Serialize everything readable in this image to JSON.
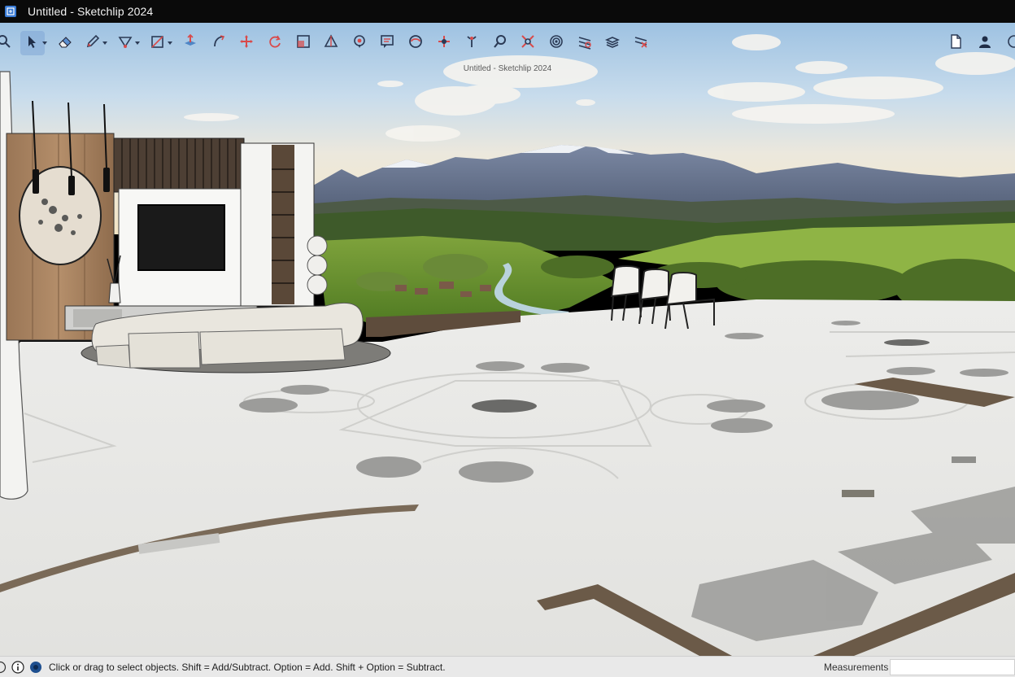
{
  "window": {
    "title": "Untitled - Sketchlip 2024"
  },
  "viewport": {
    "overlay_title": "Untitled - Sketchlip 2024"
  },
  "toolbar": {
    "tools": [
      {
        "name": "search-tool",
        "icon": "magnifier-icon"
      },
      {
        "name": "select-tool",
        "icon": "arrow-cursor-icon",
        "active": true,
        "dropdown": true
      },
      {
        "name": "eraser-tool",
        "icon": "eraser-icon"
      },
      {
        "name": "pencil-tool",
        "icon": "pencil-icon",
        "dropdown": true
      },
      {
        "name": "arc-tool",
        "icon": "arc-icon",
        "dropdown": true
      },
      {
        "name": "rectangle-tool",
        "icon": "rectangle-icon",
        "dropdown": true
      },
      {
        "name": "push-pull-tool",
        "icon": "push-pull-icon"
      },
      {
        "name": "follow-me-tool",
        "icon": "follow-me-icon"
      },
      {
        "name": "move-tool",
        "icon": "move-icon"
      },
      {
        "name": "rotate-tool",
        "icon": "rotate-icon"
      },
      {
        "name": "scale-tool",
        "icon": "scale-icon"
      },
      {
        "name": "tape-measure-tool",
        "icon": "triangle-icon"
      },
      {
        "name": "paint-tool",
        "icon": "paint-icon"
      },
      {
        "name": "text-tool",
        "icon": "text-box-icon"
      },
      {
        "name": "orbit-tool",
        "icon": "orbit-icon"
      },
      {
        "name": "pan-tool",
        "icon": "pan-icon"
      },
      {
        "name": "walk-tool",
        "icon": "walk-icon"
      },
      {
        "name": "zoom-tool",
        "icon": "zoom-icon"
      },
      {
        "name": "zoom-extents-tool",
        "icon": "zoom-extents-icon"
      },
      {
        "name": "position-camera-tool",
        "icon": "camera-target-icon"
      },
      {
        "name": "section-plane-tool",
        "icon": "section-plane-icon"
      },
      {
        "name": "layers-tool",
        "icon": "layers-icon"
      },
      {
        "name": "section-display-tool",
        "icon": "section-display-icon"
      }
    ],
    "right_tools": [
      {
        "name": "document-button",
        "icon": "document-icon"
      },
      {
        "name": "account-button",
        "icon": "user-icon"
      },
      {
        "name": "info-button",
        "icon": "circle-icon"
      }
    ],
    "accent": "#2b6cb0"
  },
  "statusbar": {
    "hint": "Click or drag to select objects. Shift = Add/Subtract. Option = Add. Shift + Option = Subtract.",
    "measurements_label": "Measurements",
    "measurements_value": ""
  }
}
